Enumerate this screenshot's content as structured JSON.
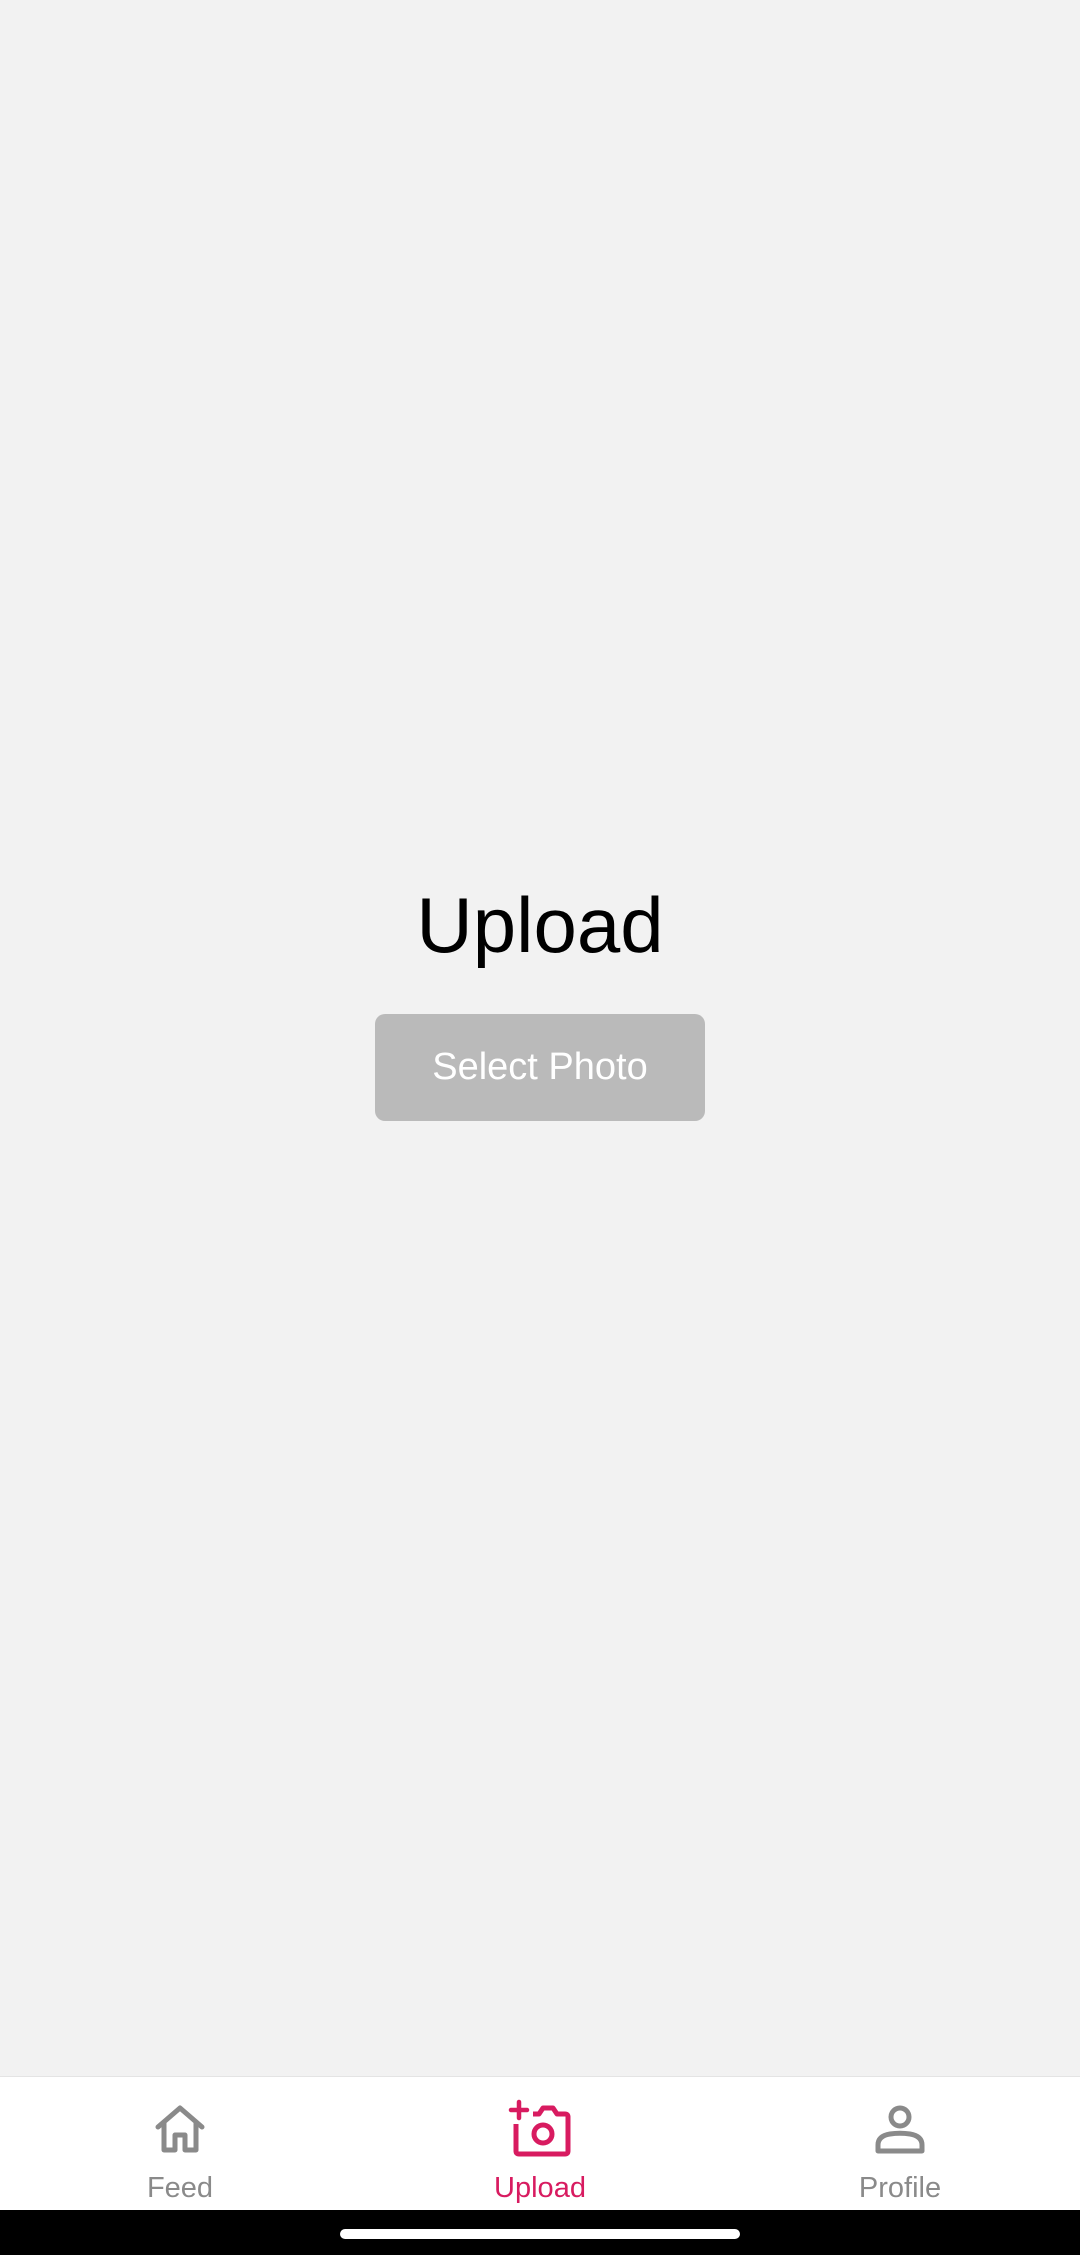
{
  "main": {
    "title": "Upload",
    "select_photo_label": "Select Photo"
  },
  "bottom_nav": {
    "items": [
      {
        "label": "Feed",
        "icon": "home-icon",
        "active": false
      },
      {
        "label": "Upload",
        "icon": "add-photo-icon",
        "active": true
      },
      {
        "label": "Profile",
        "icon": "person-icon",
        "active": false
      }
    ]
  },
  "colors": {
    "background": "#f2f2f2",
    "accent": "#d81b60",
    "inactive": "#8a8a8a",
    "button": "#bababa"
  }
}
